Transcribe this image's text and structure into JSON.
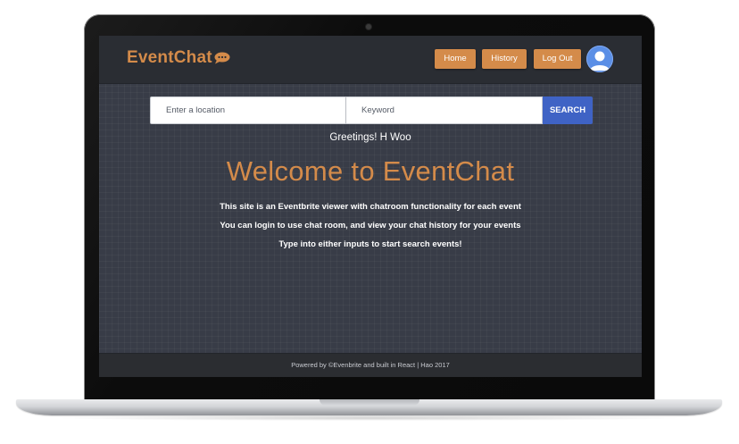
{
  "navbar": {
    "brand": "EventChat",
    "brand_icon": "speech-bubble-icon",
    "buttons": {
      "home": "Home",
      "history": "History",
      "logout": "Log Out"
    },
    "avatar_icon": "user-avatar-icon"
  },
  "search": {
    "location_placeholder": "Enter a location",
    "location_value": "",
    "keyword_placeholder": "Keyword",
    "keyword_value": "",
    "button_label": "SEARCH"
  },
  "main": {
    "greeting": "Greetings! H Woo",
    "title": "Welcome to EventChat",
    "lines": [
      "This site is an Eventbrite viewer with chatroom functionality for each event",
      "You can login to use chat room, and view your chat history for your events",
      "Type into either inputs to start search events!"
    ]
  },
  "footer": {
    "text": "Powered by ©Evenbrite and built in React | Hao 2017"
  },
  "colors": {
    "accent": "#d48b4a",
    "search_button": "#3f63c5",
    "background": "#383c47",
    "navbar": "#2a2d33"
  }
}
